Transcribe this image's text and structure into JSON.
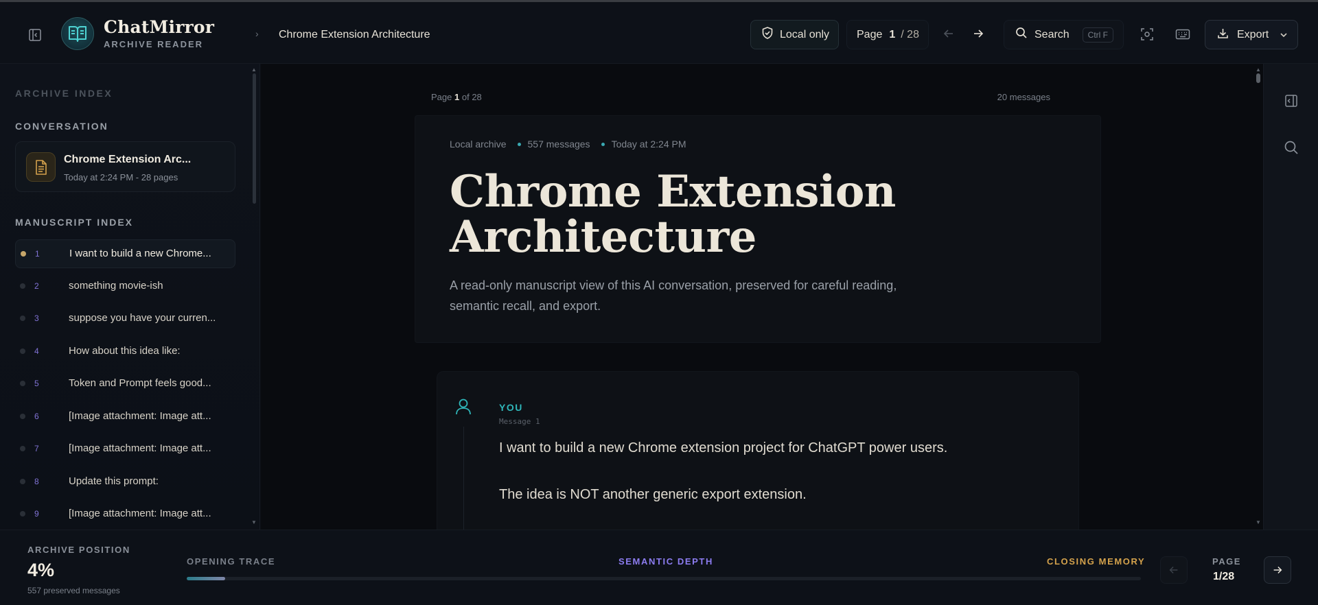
{
  "app": {
    "name": "ChatMirror",
    "subtitle": "ARCHIVE READER"
  },
  "header": {
    "breadcrumb_title": "Chrome Extension Architecture",
    "local_label": "Local only",
    "page_label": "Page",
    "page_current": "1",
    "page_total": "/ 28",
    "search_label": "Search",
    "search_shortcut": "Ctrl F",
    "export_label": "Export"
  },
  "sidebar": {
    "archive_index_label": "ARCHIVE INDEX",
    "conversation_label": "CONVERSATION",
    "conversation": {
      "title": "Chrome Extension Arc...",
      "meta": "Today at 2:24 PM - 28 pages"
    },
    "manuscript_label": "MANUSCRIPT INDEX",
    "items": [
      {
        "num": "1",
        "text": "I want to build a new Chrome..."
      },
      {
        "num": "2",
        "text": "something movie-ish"
      },
      {
        "num": "3",
        "text": "suppose you have your curren..."
      },
      {
        "num": "4",
        "text": "How about this idea like:"
      },
      {
        "num": "5",
        "text": "Token and Prompt feels good..."
      },
      {
        "num": "6",
        "text": "[Image attachment: Image att..."
      },
      {
        "num": "7",
        "text": "[Image attachment: Image att..."
      },
      {
        "num": "8",
        "text": "Update this prompt:"
      },
      {
        "num": "9",
        "text": "[Image attachment: Image att..."
      }
    ]
  },
  "main": {
    "page_meta_prefix": "Page",
    "page_meta_num": "1",
    "page_meta_suffix": "of 28",
    "message_count": "20 messages",
    "hero": {
      "source": "Local archive",
      "messages": "557 messages",
      "time": "Today at 2:24 PM",
      "title": "Chrome Extension Architecture",
      "description": "A read-only manuscript view of this AI conversation, preserved for careful reading, semantic recall, and export."
    },
    "message": {
      "role": "YOU",
      "index": "Message 1",
      "paragraphs": [
        "I want to build a new Chrome extension project for ChatGPT power users.",
        "The idea is NOT another generic export extension."
      ]
    }
  },
  "footer": {
    "position_label": "ARCHIVE POSITION",
    "position_pct": "4%",
    "position_fraction": 0.04,
    "preserved": "557 preserved messages",
    "track_open": "OPENING TRACE",
    "track_semantic": "SEMANTIC DEPTH",
    "track_close": "CLOSING MEMORY",
    "page_label": "PAGE",
    "page_value": "1/28"
  },
  "colors": {
    "accent_teal": "#2fb6b9",
    "accent_violet": "#8c7cf0",
    "accent_gold": "#d4a24c",
    "background": "#090b0f"
  }
}
